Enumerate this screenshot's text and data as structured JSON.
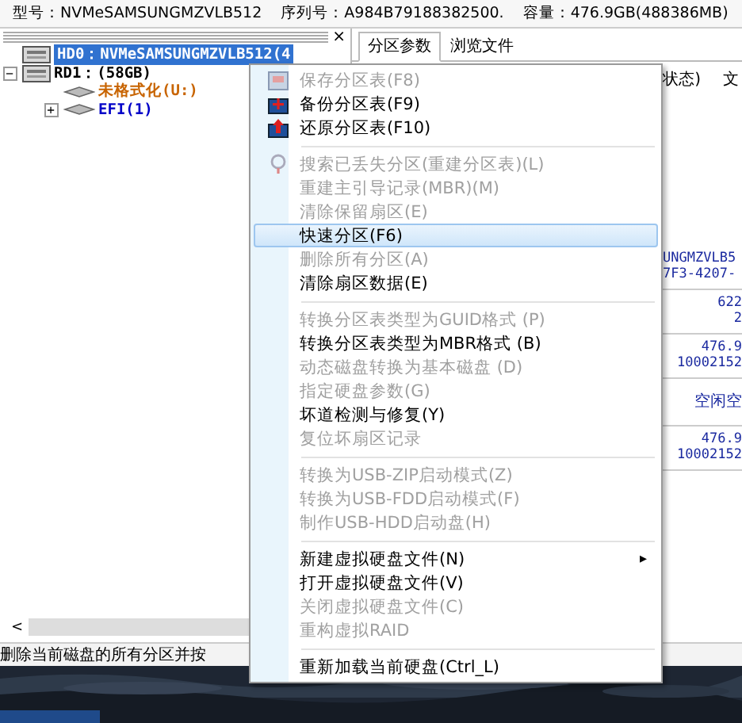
{
  "info_bar": [
    "型号：NVMeSAMSUNGMZVLB512",
    "序列号：A984B79188382500.",
    "容量：476.9GB(488386MB)"
  ],
  "tree": {
    "close": "×",
    "scroll_left": "<",
    "nodes": [
      {
        "label": "HD0：NVMeSAMSUNGMZVLB512(4",
        "kind": "disk",
        "selected": true
      },
      {
        "label": "RD1：(58GB)",
        "kind": "disk",
        "selected": false,
        "toggle": "−",
        "children": [
          {
            "label": "未格式化(U:)",
            "kind": "partition",
            "color": "#c86400"
          },
          {
            "label": "EFI(1)",
            "kind": "partition",
            "color": "#0000c8",
            "toggle": "+"
          }
        ]
      }
    ]
  },
  "tabs": [
    {
      "label": "分区参数",
      "selected": true
    },
    {
      "label": "浏览文件",
      "selected": false
    }
  ],
  "table": {
    "header": [
      "状态)",
      "文"
    ],
    "rows": [
      [
        "UNGMZVLB5",
        "7F3-4207-"
      ],
      [
        "622",
        "2"
      ],
      [
        "476.9",
        "10002152"
      ],
      [
        "空闲空"
      ],
      [
        "476.9",
        "10002152"
      ]
    ]
  },
  "status_bar": "删除当前磁盘的所有分区并按",
  "menu": [
    [
      {
        "label": "保存分区表(F8)",
        "enabled": false,
        "selected": false
      },
      {
        "label": "备份分区表(F9)",
        "enabled": true,
        "selected": false
      },
      {
        "label": "还原分区表(F10)",
        "enabled": true,
        "selected": false
      }
    ],
    [
      {
        "label": "搜索已丢失分区(重建分区表)(L)",
        "enabled": false,
        "selected": false
      },
      {
        "label": "重建主引导记录(MBR)(M)",
        "enabled": false,
        "selected": false
      },
      {
        "label": "清除保留扇区(E)",
        "enabled": false,
        "selected": false
      },
      {
        "label": "快速分区(F6)",
        "enabled": true,
        "selected": true
      },
      {
        "label": "删除所有分区(A)",
        "enabled": false,
        "selected": false
      },
      {
        "label": "清除扇区数据(E)",
        "enabled": true,
        "selected": false
      }
    ],
    [
      {
        "label": "转换分区表类型为GUID格式 (P)",
        "enabled": false,
        "selected": false
      },
      {
        "label": "转换分区表类型为MBR格式 (B)",
        "enabled": true,
        "selected": false
      },
      {
        "label": "动态磁盘转换为基本磁盘 (D)",
        "enabled": false,
        "selected": false
      },
      {
        "label": "指定硬盘参数(G)",
        "enabled": false,
        "selected": false
      },
      {
        "label": "坏道检测与修复(Y)",
        "enabled": true,
        "selected": false
      },
      {
        "label": "复位坏扇区记录",
        "enabled": false,
        "selected": false
      }
    ],
    [
      {
        "label": "转换为USB-ZIP启动模式(Z)",
        "enabled": false,
        "selected": false
      },
      {
        "label": "转换为USB-FDD启动模式(F)",
        "enabled": false,
        "selected": false
      },
      {
        "label": "制作USB-HDD启动盘(H)",
        "enabled": false,
        "selected": false
      }
    ],
    [
      {
        "label": "新建虚拟硬盘文件(N)",
        "enabled": true,
        "selected": false,
        "submenu": "▸"
      },
      {
        "label": "打开虚拟硬盘文件(V)",
        "enabled": true,
        "selected": false
      },
      {
        "label": "关闭虚拟硬盘文件(C)",
        "enabled": false,
        "selected": false
      },
      {
        "label": "重构虚拟RAID",
        "enabled": false,
        "selected": false
      }
    ],
    [
      {
        "label": "重新加载当前硬盘(Ctrl_L)",
        "enabled": true,
        "selected": false
      }
    ]
  ]
}
